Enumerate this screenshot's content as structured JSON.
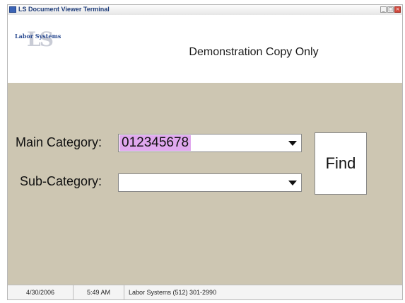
{
  "window": {
    "title": "LS Document Viewer Terminal",
    "controls": [
      "minimize-icon",
      "maximize-icon",
      "close-icon"
    ]
  },
  "header": {
    "logo_mark": "LS",
    "logo_text": "Labor Systems",
    "demo_title": "Demonstration Copy Only"
  },
  "form": {
    "main_category": {
      "label": "Main Category:",
      "value": "012345678"
    },
    "sub_category": {
      "label": "Sub-Category:",
      "value": ""
    },
    "find_label": "Find"
  },
  "status": {
    "date": "4/30/2006",
    "time": "5:49 AM",
    "info": "Labor Systems  (512) 301-2990"
  },
  "colors": {
    "panel_background": "#cdc6b2",
    "selection_highlight": "#e0a8ee",
    "logo_blue": "#2c4c91"
  }
}
